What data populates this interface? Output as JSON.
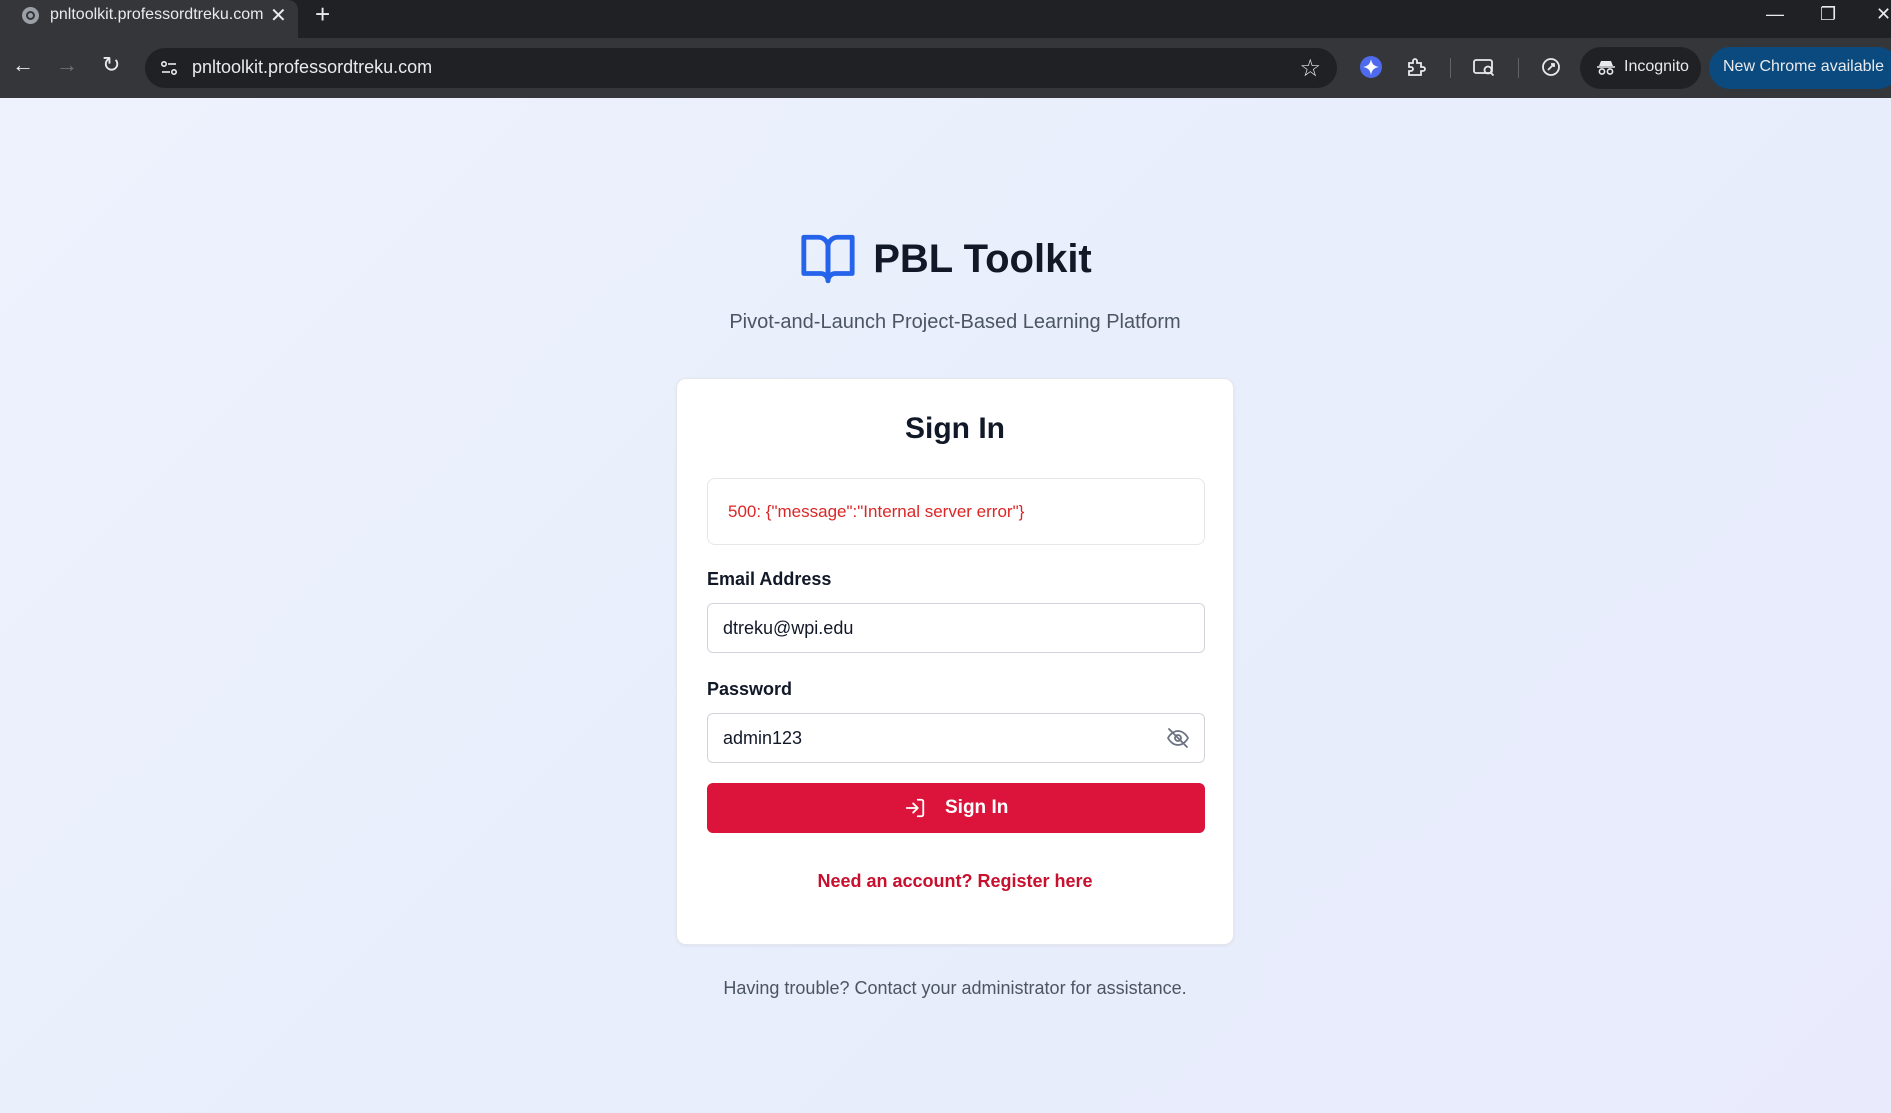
{
  "browser": {
    "tab_title": "pnltoolkit.professordtreku.com",
    "tab_close": "✕",
    "new_tab": "+",
    "window_controls": {
      "minimize": "—",
      "restore": "❐",
      "close": "✕"
    },
    "nav": {
      "back": "←",
      "forward": "→",
      "reload": "↻"
    },
    "url": "pnltoolkit.professordtreku.com",
    "bookmark": "☆",
    "incognito_label": "Incognito",
    "update_label": "New Chrome available",
    "update_menu": "⋮",
    "toolbar_icons": [
      "gemini-icon",
      "extensions-icon",
      "tab-search-icon",
      "performance-icon"
    ]
  },
  "page": {
    "brand": {
      "title": "PBL Toolkit",
      "icon": "book-open-icon",
      "accent": "#2563eb"
    },
    "tagline": "Pivot-and-Launch Project-Based Learning Platform",
    "card": {
      "title": "Sign In",
      "error_message": "500: {\"message\":\"Internal server error\"}",
      "email_label": "Email Address",
      "email_value": "dtreku@wpi.edu",
      "password_label": "Password",
      "password_value": "admin123",
      "password_toggle_icon": "eye-off-icon",
      "submit_label": "Sign In",
      "submit_icon": "log-in-icon",
      "register_link": "Need an account? Register here"
    },
    "help_text": "Having trouble? Contact your administrator for assistance.",
    "colors": {
      "primary_button": "#dc143c",
      "error": "#dc2626",
      "link": "#c8102e"
    }
  }
}
